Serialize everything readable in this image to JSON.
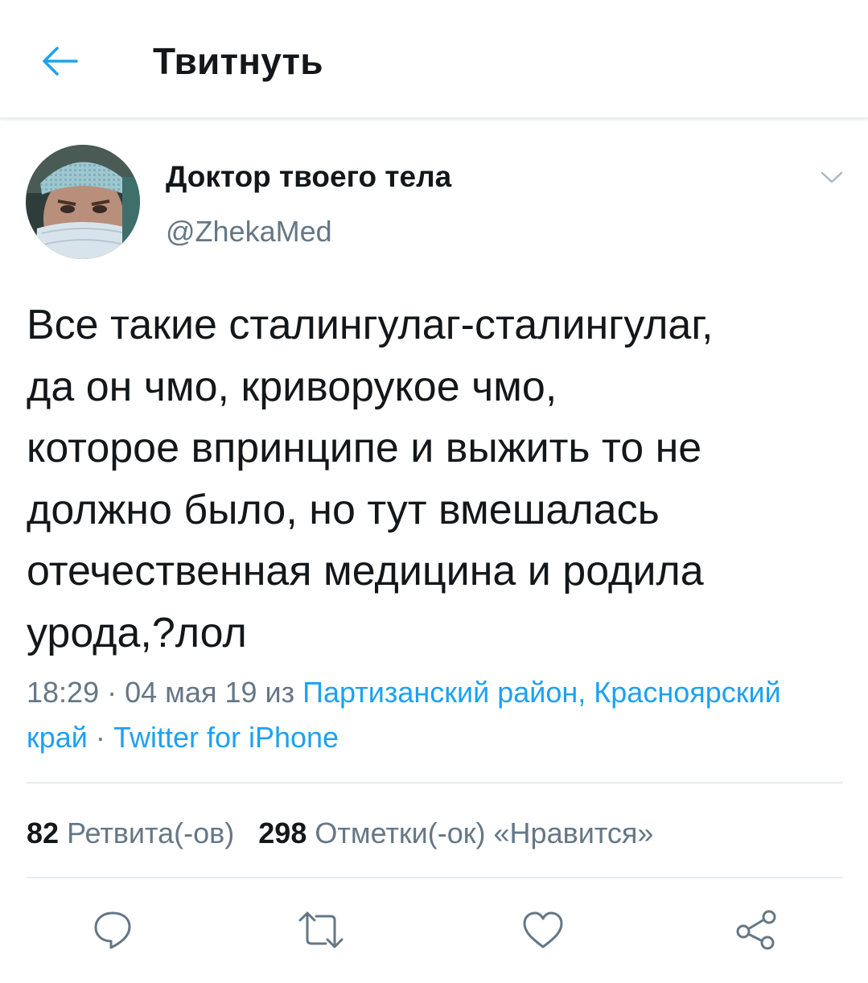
{
  "header": {
    "title": "Твитнуть",
    "back_icon": "arrow-left-icon",
    "accent_color": "#1da1f2"
  },
  "tweet": {
    "author": {
      "name": "Доктор твоего тела",
      "handle": "@ZhekaMed"
    },
    "text": "Все такие сталингулаг-сталингулаг,\nда он чмо, криворукое чмо,\nкоторое впринципе и выжить то не\nдолжно было, но тут вмешалась\nотечественная медицина и родила\nурода,?лол",
    "meta": {
      "time": "18:29",
      "separator": "·",
      "date": "04 мая 19",
      "from_word": "из",
      "location": "Партизанский район, Красноярский край",
      "source": "Twitter for iPhone"
    },
    "stats": {
      "retweets_count": "82",
      "retweets_label": "Ретвита(-ов)",
      "likes_count": "298",
      "likes_label": "Отметки(-ок) «Нравится»"
    }
  },
  "actions": {
    "reply_icon": "reply-icon",
    "retweet_icon": "retweet-icon",
    "like_icon": "heart-icon",
    "share_icon": "share-icon"
  },
  "colors": {
    "text": "#14171a",
    "secondary": "#657786",
    "link": "#1da1f2",
    "divider": "#e6ecf0"
  }
}
